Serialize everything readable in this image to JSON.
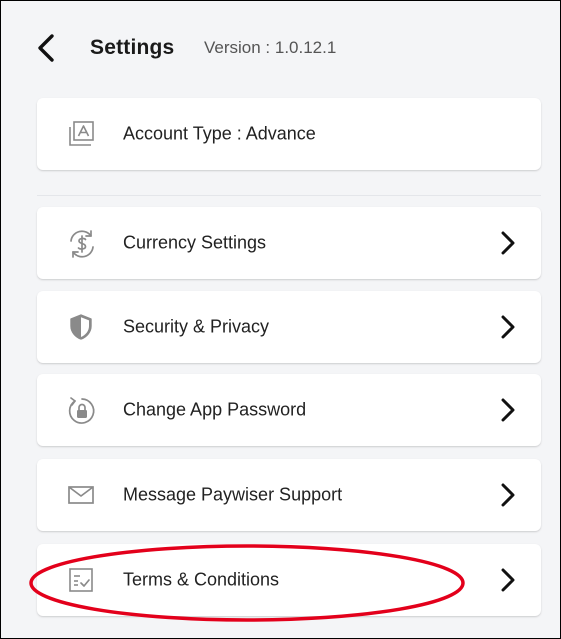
{
  "header": {
    "title": "Settings",
    "version": "Version : 1.0.12.1"
  },
  "account": {
    "label": "Account Type : Advance",
    "icon": "account-type-icon"
  },
  "menu": [
    {
      "label": "Currency Settings",
      "icon": "currency-settings-icon"
    },
    {
      "label": "Security & Privacy",
      "icon": "shield-icon"
    },
    {
      "label": "Change App Password",
      "icon": "lock-rotate-icon"
    },
    {
      "label": "Message Paywiser Support",
      "icon": "envelope-icon"
    },
    {
      "label": "Terms & Conditions",
      "icon": "terms-checklist-icon"
    }
  ],
  "colors": {
    "background": "#f4f5f7",
    "card": "#ffffff",
    "icon": "#8a8a8a",
    "text": "#222222",
    "highlight": "#e3001b"
  }
}
